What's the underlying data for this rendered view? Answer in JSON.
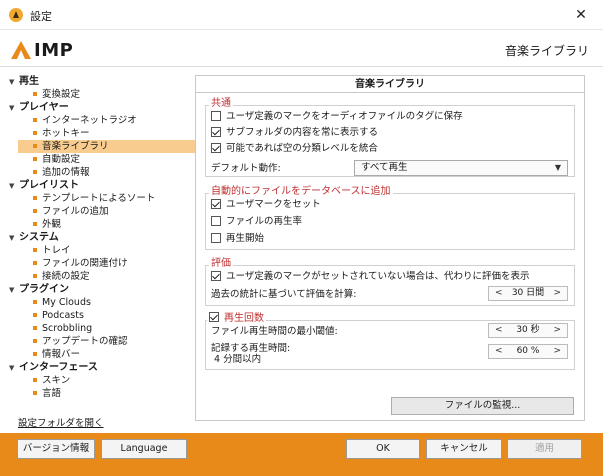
{
  "window": {
    "title": "設定",
    "close_glyph": "✕"
  },
  "header": {
    "logo_text": "IMP",
    "section_title": "音楽ライブラリ"
  },
  "sidebar": {
    "categories": [
      {
        "label": "再生",
        "items": [
          "変換設定"
        ]
      },
      {
        "label": "プレイヤー",
        "items": [
          "インターネットラジオ",
          "ホットキー",
          "音楽ライブラリ",
          "自動設定",
          "追加の情報"
        ]
      },
      {
        "label": "プレイリスト",
        "items": [
          "テンプレートによるソート",
          "ファイルの追加",
          "外観"
        ]
      },
      {
        "label": "システム",
        "items": [
          "トレイ",
          "ファイルの関連付け",
          "接続の設定"
        ]
      },
      {
        "label": "プラグイン",
        "items": [
          "My Clouds",
          "Podcasts",
          "Scrobbling",
          "アップデートの確認",
          "情報バー"
        ]
      },
      {
        "label": "インターフェース",
        "items": [
          "スキン",
          "言語"
        ]
      }
    ],
    "selected": "音楽ライブラリ",
    "open_settings_folder": "設定フォルダを開く"
  },
  "panel": {
    "title": "音楽ライブラリ",
    "general": {
      "legend": "共通",
      "save_marks_to_tags": {
        "label": "ユーザ定義のマークをオーディオファイルのタグに保存",
        "checked": false
      },
      "always_show_subfolder_contents": {
        "label": "サブフォルダの内容を常に表示する",
        "checked": true
      },
      "merge_empty_levels": {
        "label": "可能であれば空の分類レベルを統合",
        "checked": true
      },
      "default_action_label": "デフォルト動作:",
      "default_action_value": "すべて再生"
    },
    "auto_add": {
      "legend": "自動的にファイルをデータベースに追加",
      "set_user_mark": {
        "label": "ユーザマークをセット",
        "checked": true
      },
      "file_play_rate": {
        "label": "ファイルの再生率",
        "checked": false
      },
      "play_start": {
        "label": "再生開始",
        "checked": false
      }
    },
    "rating": {
      "legend": "評価",
      "show_rating_instead": {
        "label": "ユーザ定義のマークがセットされていない場合は、代わりに評価を表示",
        "checked": true
      },
      "stats_period_label": "過去の統計に基づいて評価を計算:",
      "stats_period_value": "30 日間"
    },
    "play_count": {
      "legend": "再生回数",
      "enabled": true,
      "min_threshold_label": "ファイル再生時間の最小閾値:",
      "min_threshold_value": "30 秒",
      "record_time_label": "記録する再生時間:",
      "record_time_sub": "4 分間以内",
      "record_time_value": "60 %"
    },
    "watch_files_button": "ファイルの監視..."
  },
  "bottom": {
    "version_info": "バージョン情報",
    "language": "Language",
    "ok": "OK",
    "cancel": "キャンセル",
    "apply": "適用"
  },
  "colors": {
    "accent": "#e88a1a",
    "selection": "#f8cc8e",
    "legend_text": "#c03030"
  }
}
